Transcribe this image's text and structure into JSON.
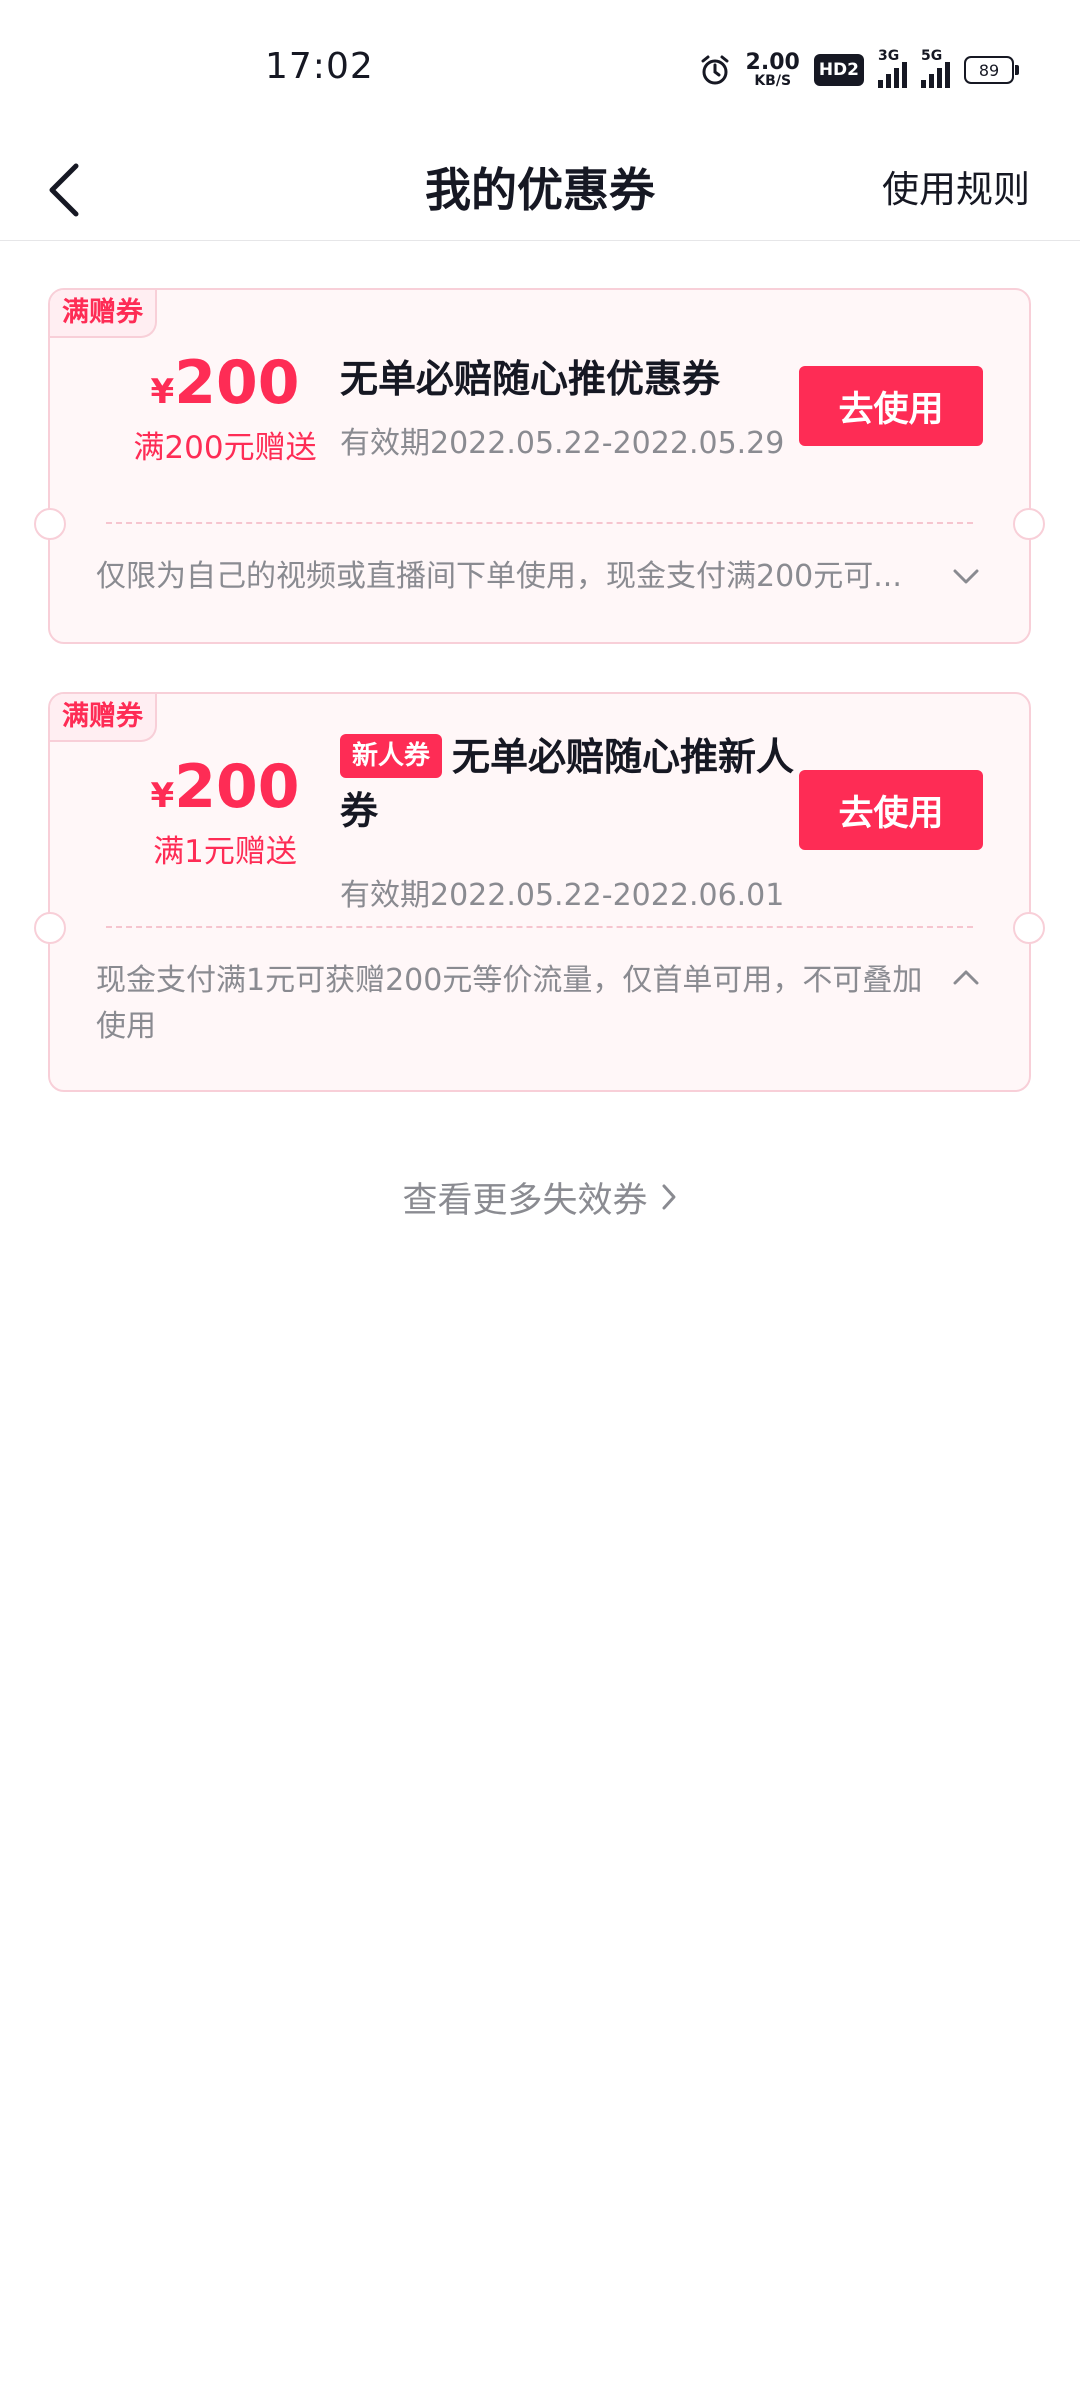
{
  "status_bar": {
    "time": "17:02",
    "net_speed_value": "2.00",
    "net_speed_unit": "KB/S",
    "hd_badge": "HD2",
    "sim1_label": "3G",
    "sim2_label": "5G",
    "battery": "89"
  },
  "nav": {
    "title": "我的优惠券",
    "rules_link": "使用规则"
  },
  "coupons": [
    {
      "tag": "满赠券",
      "currency": "¥",
      "amount": "200",
      "condition": "满200元赠送",
      "name": "无单必赔随心推优惠券",
      "validity": "有效期2022.05.22-2022.05.29",
      "button": "去使用",
      "description": "仅限为自己的视频或直播间下单使用，现金支付满200元可...",
      "expanded": false
    },
    {
      "tag": "满赠券",
      "currency": "¥",
      "amount": "200",
      "condition": "满1元赠送",
      "badge": "新人券",
      "name": "无单必赔随心推新人券",
      "validity": "有效期2022.05.22-2022.06.01",
      "button": "去使用",
      "description": "现金支付满1元可获赠200元等价流量，仅首单可用，不可叠加使用",
      "expanded": true
    }
  ],
  "more_link": "查看更多失效券",
  "colors": {
    "accent": "#fe2c55",
    "card_bg": "#fff7f8",
    "card_border": "#f8cfd8",
    "muted_text": "#8a8b91",
    "primary_text": "#161823"
  }
}
